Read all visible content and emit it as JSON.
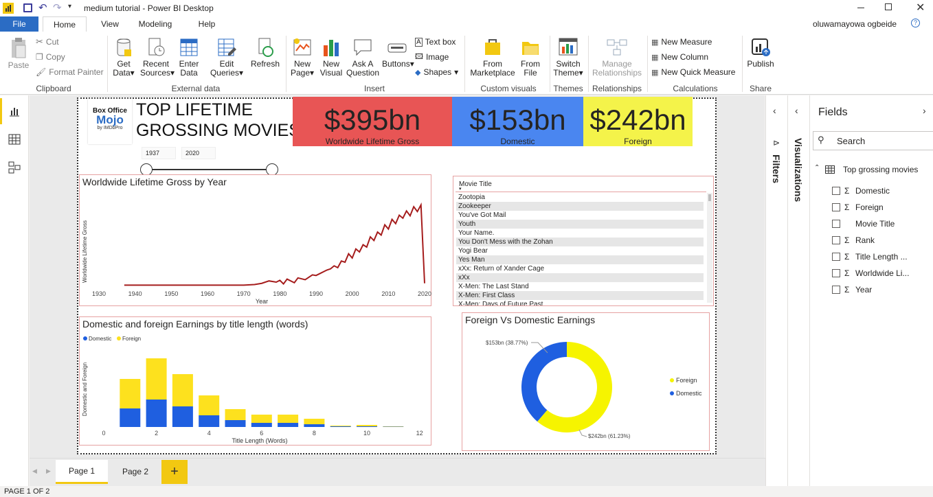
{
  "window": {
    "title": "medium tutorial - Power BI Desktop"
  },
  "tabs": [
    {
      "label": "File"
    },
    {
      "label": "Home"
    },
    {
      "label": "View"
    },
    {
      "label": "Modeling"
    },
    {
      "label": "Help"
    }
  ],
  "user": {
    "name": "oluwamayowa ogbeide"
  },
  "ribbon": {
    "clipboard": {
      "paste": "Paste",
      "cut": "Cut",
      "copy": "Copy",
      "format_painter": "Format Painter",
      "group": "Clipboard"
    },
    "external": {
      "get_data_1": "Get",
      "get_data_2": "Data",
      "recent_1": "Recent",
      "recent_2": "Sources",
      "enter_1": "Enter",
      "enter_2": "Data",
      "edit_1": "Edit",
      "edit_2": "Queries",
      "refresh": "Refresh",
      "group": "External data"
    },
    "insert": {
      "new_page_1": "New",
      "new_page_2": "Page",
      "new_visual_1": "New",
      "new_visual_2": "Visual",
      "ask_1": "Ask A",
      "ask_2": "Question",
      "buttons": "Buttons",
      "text_box": "Text box",
      "image": "Image",
      "shapes": "Shapes",
      "group": "Insert"
    },
    "custom": {
      "marketplace_1": "From",
      "marketplace_2": "Marketplace",
      "file_1": "From",
      "file_2": "File",
      "group": "Custom visuals"
    },
    "themes": {
      "switch_1": "Switch",
      "switch_2": "Theme",
      "group": "Themes"
    },
    "relationships": {
      "manage_1": "Manage",
      "manage_2": "Relationships",
      "group": "Relationships"
    },
    "calculations": {
      "new_measure": "New Measure",
      "new_column": "New Column",
      "new_quick": "New Quick Measure",
      "group": "Calculations"
    },
    "share": {
      "publish": "Publish",
      "group": "Share"
    }
  },
  "report": {
    "logo": {
      "line1": "Box Office",
      "line2": "Mojo",
      "line3": "by IMDbPro"
    },
    "heading_1": "TOP LIFETIME",
    "heading_2": "GROSSING MOVIES",
    "slider": {
      "from": "1937",
      "to": "2020"
    },
    "cards": [
      {
        "value": "$395bn",
        "label": "Worldwide Lifetime Gross",
        "color": "#e85555"
      },
      {
        "value": "$153bn",
        "label": "Domestic",
        "color": "#4a86f0"
      },
      {
        "value": "$242bn",
        "label": "Foreign",
        "color": "#f4f34a"
      }
    ],
    "movie_list": {
      "header": "Movie Title",
      "items": [
        "Zootopia",
        "Zookeeper",
        "You've Got Mail",
        "Youth",
        "Your Name.",
        "You Don't Mess with the Zohan",
        "Yogi Bear",
        "Yes Man",
        "xXx: Return of Xander Cage",
        "xXx",
        "X-Men: The Last Stand",
        "X-Men: First Class",
        "X-Men: Days of Future Past"
      ]
    }
  },
  "chart_data": [
    {
      "type": "line",
      "title": "Worldwide Lifetime Gross by Year",
      "xlabel": "Year",
      "ylabel": "Worldwide Lifetime Gross",
      "xlim": [
        1930,
        2020
      ],
      "x_ticks": [
        "1930",
        "1940",
        "1950",
        "1960",
        "1970",
        "1980",
        "1990",
        "2000",
        "2010",
        "2020"
      ],
      "color": "#a51c1c",
      "x": [
        1937,
        1940,
        1945,
        1950,
        1955,
        1960,
        1965,
        1970,
        1973,
        1975,
        1977,
        1979,
        1980,
        1981,
        1982,
        1984,
        1985,
        1987,
        1989,
        1990,
        1991,
        1993,
        1994,
        1995,
        1996,
        1997,
        1998,
        1999,
        2000,
        2001,
        2002,
        2003,
        2004,
        2005,
        2006,
        2007,
        2008,
        2009,
        2010,
        2011,
        2012,
        2013,
        2014,
        2015,
        2016,
        2017,
        2018,
        2019,
        2020
      ],
      "values": [
        0.3,
        0.3,
        0.3,
        0.3,
        0.3,
        0.3,
        0.3,
        0.3,
        0.4,
        0.6,
        1.0,
        0.8,
        1.1,
        0.5,
        1.3,
        0.7,
        1.5,
        1.2,
        2.0,
        1.9,
        2.2,
        2.8,
        3.0,
        3.5,
        3.2,
        4.3,
        4.1,
        5.5,
        4.8,
        6.3,
        5.8,
        7.0,
        6.6,
        8.3,
        7.7,
        9.1,
        8.6,
        10.3,
        9.6,
        11.2,
        10.5,
        11.9,
        11.4,
        12.6,
        11.8,
        13.3,
        12.5,
        13.6,
        0.6
      ]
    },
    {
      "type": "bar",
      "title": "Domestic and foreign Earnings by title length (words)",
      "xlabel": "Title Length (Words)",
      "ylabel": "Domestic and Foreign",
      "legend": "top-left",
      "x_ticks": [
        "0",
        "2",
        "4",
        "6",
        "8",
        "10",
        "12"
      ],
      "categories": [
        1,
        2,
        3,
        4,
        5,
        6,
        7,
        8,
        9,
        10,
        11
      ],
      "series": [
        {
          "name": "Domestic",
          "color": "#1f5fe0",
          "values": [
            27,
            40,
            30,
            17,
            10,
            6,
            6,
            4,
            1,
            1,
            0.5
          ]
        },
        {
          "name": "Foreign",
          "color": "#fde11e",
          "values": [
            43,
            60,
            47,
            29,
            16,
            12,
            12,
            8,
            1,
            2,
            0.5
          ]
        }
      ]
    },
    {
      "type": "pie",
      "title": "Foreign Vs Domestic Earnings",
      "legend": "right",
      "slices": [
        {
          "name": "Foreign",
          "value": 242,
          "label": "$242bn (61.23%)",
          "color": "#f6f400"
        },
        {
          "name": "Domestic",
          "value": 153,
          "label": "$153bn (38.77%)",
          "color": "#1f5fe0"
        }
      ]
    }
  ],
  "panes": {
    "filters": "Filters",
    "visualizations": "Visualizations",
    "fields": "Fields",
    "search_placeholder": "Search",
    "table_name": "Top grossing movies",
    "fields_list": [
      {
        "name": "Domestic",
        "sigma": "Σ"
      },
      {
        "name": "Foreign",
        "sigma": "Σ"
      },
      {
        "name": "Movie Title",
        "sigma": ""
      },
      {
        "name": "Rank",
        "sigma": "Σ"
      },
      {
        "name": "Title Length ...",
        "sigma": "Σ"
      },
      {
        "name": "Worldwide Li...",
        "sigma": "Σ"
      },
      {
        "name": "Year",
        "sigma": "Σ"
      }
    ]
  },
  "pages": [
    {
      "label": "Page 1"
    },
    {
      "label": "Page 2"
    }
  ],
  "add_page": "+",
  "status": "PAGE 1 OF 2"
}
